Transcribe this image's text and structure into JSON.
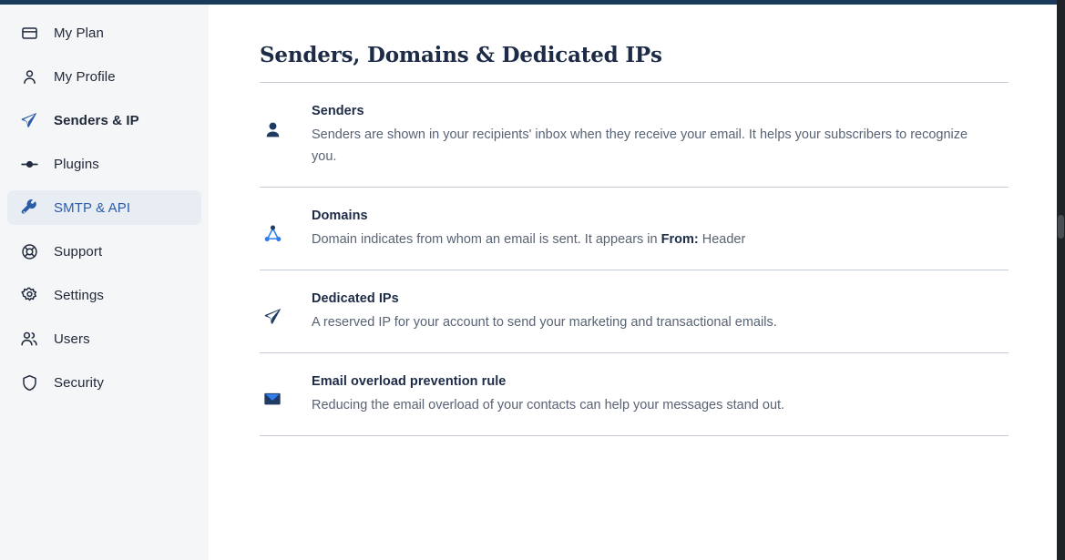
{
  "colors": {
    "top_bar": "#1a3a5c",
    "sidebar_bg": "#f5f6f8",
    "active_item_bg": "#e8edf3",
    "accent_blue": "#2a5ca8",
    "icon_navy": "#1f3a63",
    "icon_bright_blue": "#2f7ef0",
    "divider": "#c5ccd6",
    "body_text": "#586374",
    "heading_text": "#1d2b47"
  },
  "sidebar": {
    "items": [
      {
        "label": "My Plan",
        "icon": "credit-card-icon",
        "active": false,
        "bold": false
      },
      {
        "label": "My Profile",
        "icon": "person-icon",
        "active": false,
        "bold": false
      },
      {
        "label": "Senders & IP",
        "icon": "paper-plane-icon",
        "active": false,
        "bold": true
      },
      {
        "label": "Plugins",
        "icon": "plug-icon",
        "active": false,
        "bold": false
      },
      {
        "label": "SMTP & API",
        "icon": "wrench-icon",
        "active": true,
        "bold": false
      },
      {
        "label": "Support",
        "icon": "life-ring-icon",
        "active": false,
        "bold": false
      },
      {
        "label": "Settings",
        "icon": "gear-icon",
        "active": false,
        "bold": false
      },
      {
        "label": "Users",
        "icon": "users-icon",
        "active": false,
        "bold": false
      },
      {
        "label": "Security",
        "icon": "shield-icon",
        "active": false,
        "bold": false
      }
    ]
  },
  "main": {
    "title": "Senders, Domains & Dedicated IPs",
    "rows": [
      {
        "icon": "sender-avatar-icon",
        "title": "Senders",
        "desc": "Senders are shown in your recipients' inbox when they receive your email. It helps your subscribers to recognize you."
      },
      {
        "icon": "domain-network-icon",
        "title": "Domains",
        "desc_pre": "Domain indicates from whom an email is sent. It appears in ",
        "desc_strong": "From:",
        "desc_post": " Header"
      },
      {
        "icon": "dedicated-ip-plane-icon",
        "title": "Dedicated IPs",
        "desc": "A reserved IP for your account to send your marketing and transactional emails."
      },
      {
        "icon": "envelope-icon",
        "title": "Email overload prevention rule",
        "desc": "Reducing the email overload of your contacts can help your messages stand out."
      }
    ]
  }
}
